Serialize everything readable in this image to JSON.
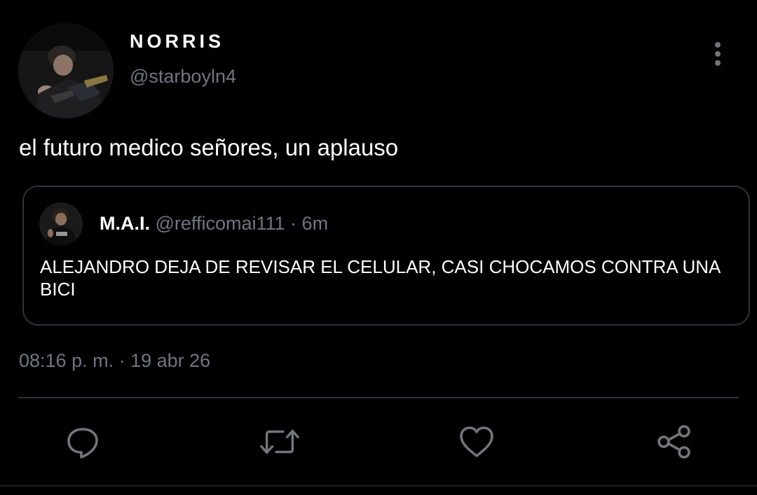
{
  "tweet": {
    "author": {
      "display_name": "NORRIS",
      "handle": "@starboyln4",
      "avatar_icon": "profile-photo"
    },
    "text": "el futuro medico señores, un aplauso",
    "timestamp": "08:16 p. m. · 19 abr 26",
    "more_icon": "more-vertical-icon"
  },
  "quote": {
    "display_name": "M.A.I.",
    "handle": "@refficomai111",
    "separator": "·",
    "time": "6m",
    "text": "ALEJANDRO DEJA DE REVISAR EL CELULAR, CASI CHOCAMOS CONTRA UNA BICI",
    "avatar_icon": "profile-photo"
  },
  "actions": [
    {
      "name": "reply",
      "icon": "reply-icon"
    },
    {
      "name": "retweet",
      "icon": "retweet-icon"
    },
    {
      "name": "like",
      "icon": "heart-icon"
    },
    {
      "name": "share",
      "icon": "share-icon"
    }
  ],
  "colors": {
    "background": "#000000",
    "text": "#ffffff",
    "secondary_text": "#6e7681",
    "border": "#2f3336",
    "icon": "#71767b"
  }
}
